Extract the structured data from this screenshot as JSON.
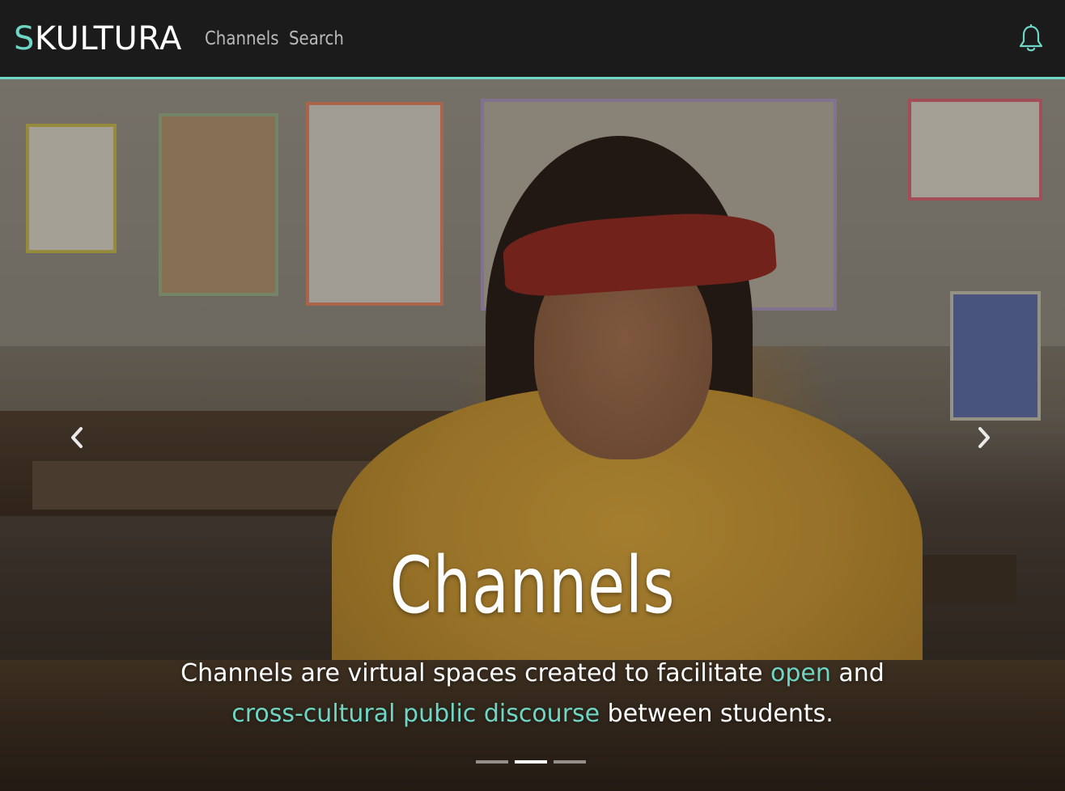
{
  "brand": {
    "first_letter": "S",
    "rest": "KULTURA"
  },
  "nav": {
    "items": [
      {
        "label": "Channels"
      },
      {
        "label": "Search"
      }
    ]
  },
  "icons": {
    "notifications": "bell-icon",
    "prev": "chevron-left-icon",
    "next": "chevron-right-icon"
  },
  "colors": {
    "accent": "#6fd6c6",
    "navbar": "#1b1b1b"
  },
  "hero": {
    "title": "Channels",
    "text_parts": {
      "p1": "Channels are virtual spaces created to facilitate ",
      "h1": "open",
      "p2": " and ",
      "h2": "cross-cultural public discourse",
      "p3": " between students."
    },
    "slides": {
      "count": 3,
      "active_index": 1
    }
  }
}
